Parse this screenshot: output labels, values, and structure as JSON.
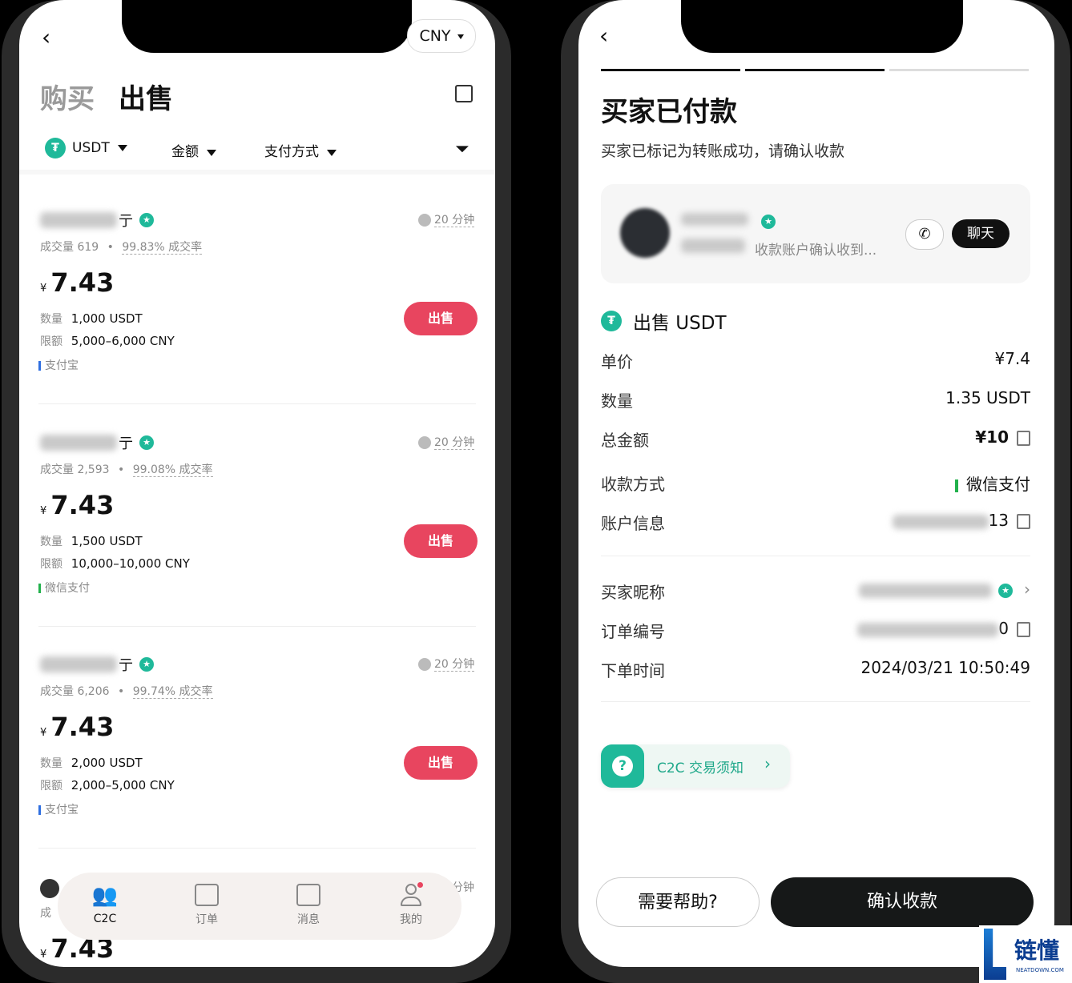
{
  "left": {
    "currency": "CNY",
    "tab_buy": "购买",
    "tab_sell": "出售",
    "filters": {
      "coin": "USDT",
      "amount": "金额",
      "payment": "支付方式"
    },
    "listings": [
      {
        "name_suffix": "亍",
        "time": "20 分钟",
        "volume": "成交量 619",
        "rate": "99.83% 成交率",
        "currency_symbol": "¥",
        "price": "7.43",
        "qty_label": "数量",
        "qty": "1,000 USDT",
        "limit_label": "限额",
        "limit": "5,000–6,000 CNY",
        "payment": "支付宝",
        "pay_color": "#2f6fe0",
        "action": "出售"
      },
      {
        "name_suffix": "亍",
        "time": "20 分钟",
        "volume": "成交量 2,593",
        "rate": "99.08% 成交率",
        "currency_symbol": "¥",
        "price": "7.43",
        "qty_label": "数量",
        "qty": "1,500 USDT",
        "limit_label": "限额",
        "limit": "10,000–10,000 CNY",
        "payment": "微信支付",
        "pay_color": "#22b14c",
        "action": "出售"
      },
      {
        "name_suffix": "亍",
        "time": "20 分钟",
        "volume": "成交量 6,206",
        "rate": "99.74% 成交率",
        "currency_symbol": "¥",
        "price": "7.43",
        "qty_label": "数量",
        "qty": "2,000 USDT",
        "limit_label": "限额",
        "limit": "2,000–5,000 CNY",
        "payment": "支付宝",
        "pay_color": "#2f6fe0",
        "action": "出售"
      }
    ],
    "partial": {
      "time": "分钟",
      "volume": "成",
      "currency_symbol": "¥",
      "price": "7.43"
    },
    "nav": [
      "C2C",
      "订单",
      "消息",
      "我的"
    ]
  },
  "right": {
    "title": "买家已付款",
    "subtitle": "买家已标记为转账成功，请确认收款",
    "counterparty_status": "收款账户确认收到...",
    "chat": "聊天",
    "section_title": "出售 USDT",
    "rows1": [
      {
        "label": "单价",
        "value": "¥7.4"
      },
      {
        "label": "数量",
        "value": "1.35 USDT"
      },
      {
        "label": "总金额",
        "value": "¥10"
      },
      {
        "label": "收款方式",
        "value": "微信支付"
      },
      {
        "label": "账户信息",
        "value": "13"
      }
    ],
    "rows2": [
      {
        "label": "买家昵称",
        "value": ""
      },
      {
        "label": "订单编号",
        "value": "0"
      },
      {
        "label": "下单时间",
        "value": "2024/03/21 10:50:49"
      }
    ],
    "notice": "C2C 交易须知",
    "help": "需要帮助?",
    "confirm": "确认收款",
    "colors": {
      "accent_green": "#1fb99a",
      "sell_red": "#e8455f",
      "wechat_green": "#22b14c"
    }
  },
  "watermark": {
    "text": "链懂",
    "sub": "NEATDOWN.COM"
  }
}
